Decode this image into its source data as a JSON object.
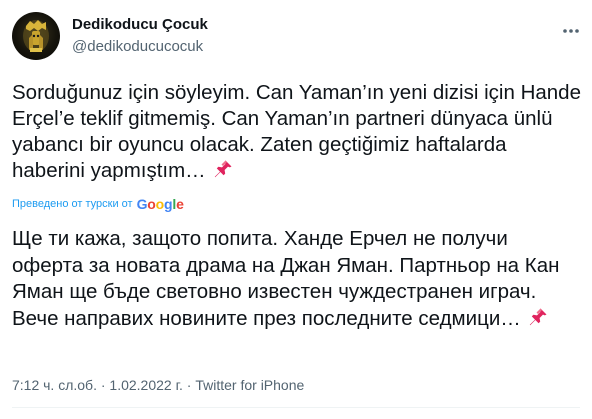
{
  "author": {
    "display_name": "Dedikoducu Çocuk",
    "handle": "@dedikoducucocuk"
  },
  "tweet": {
    "original_text": "Sorduğunuz için söyleyim. Can Yaman’ın yeni dizisi için Hande Erçel’e teklif gitmemiş. Can Yaman’ın partneri dünyaca ünlü yabancı bir oyuncu olacak. Zaten geçtiğimiz haftalarda haberini yapmıştım…",
    "translated_by_label": "Преведено от турски от",
    "translation_provider": "Google",
    "translated_text": "Ще ти кажа, защото попита. Ханде Ерчел не получи оферта за новата драма на Джан Яман. Партньор на Кан Яман ще бъде световно известен чуждестранен играч. Вече направих новините през последните седмици…",
    "trailing_emoji": "📌"
  },
  "meta": {
    "time": "7:12 ч. сл.об.",
    "separator1": " · ",
    "date": "1.02.2022 г.",
    "separator2": " · ",
    "source": "Twitter for iPhone"
  },
  "colors": {
    "text": "#0f1419",
    "secondary": "#536471",
    "link": "#1d9bf0",
    "pin": "#e0245e",
    "google_blue": "#4285F4",
    "google_red": "#EA4335",
    "google_yellow": "#FBBC05",
    "google_green": "#34A853"
  },
  "icons": {
    "more": "more-horizontal-icon",
    "pin": "pushpin-icon",
    "avatar": "lion-avatar"
  }
}
